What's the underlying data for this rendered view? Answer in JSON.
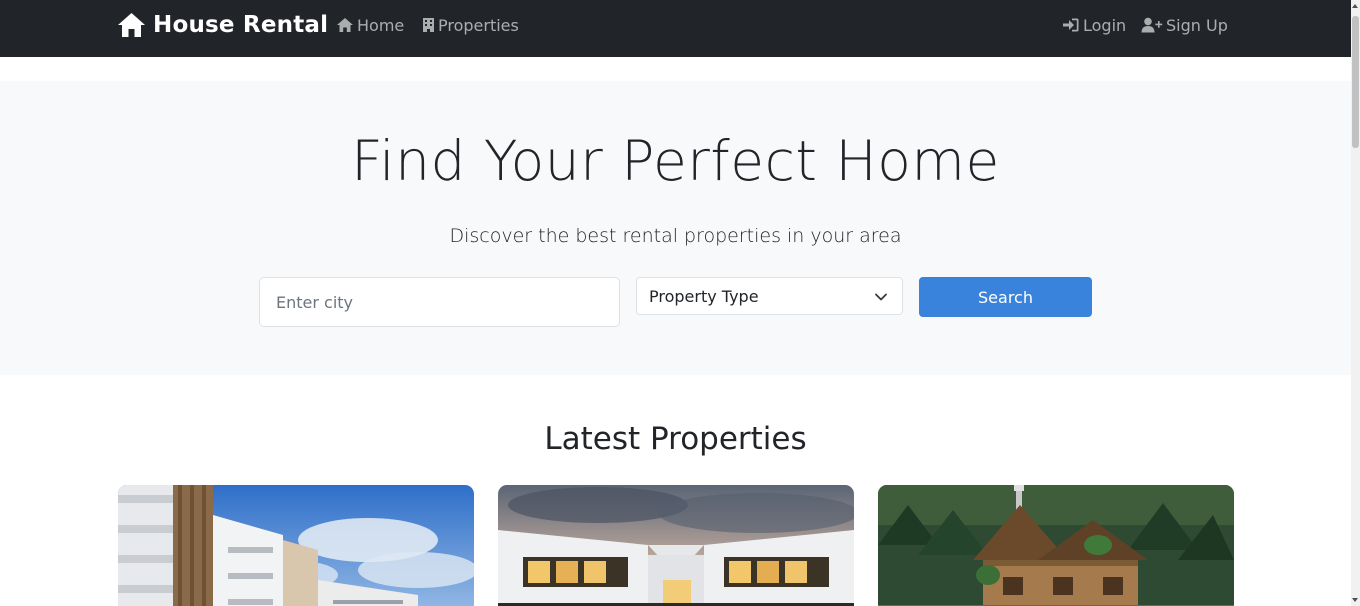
{
  "navbar": {
    "brand": "House Rental",
    "links": {
      "home": "Home",
      "properties": "Properties",
      "login": "Login",
      "signup": "Sign Up"
    }
  },
  "hero": {
    "title": "Find Your Perfect Home",
    "subtitle": "Discover the best rental properties in your area",
    "city_placeholder": "Enter city",
    "property_type_selected": "Property Type",
    "search_label": "Search"
  },
  "latest": {
    "title": "Latest Properties",
    "cards": [
      {
        "image": "apartment-building-photo"
      },
      {
        "image": "modern-white-house-photo"
      },
      {
        "image": "wooden-cottage-forest-photo"
      }
    ]
  },
  "colors": {
    "navbar_bg": "#212529",
    "hero_bg": "#f8f9fa",
    "accent": "#3a83dc"
  }
}
